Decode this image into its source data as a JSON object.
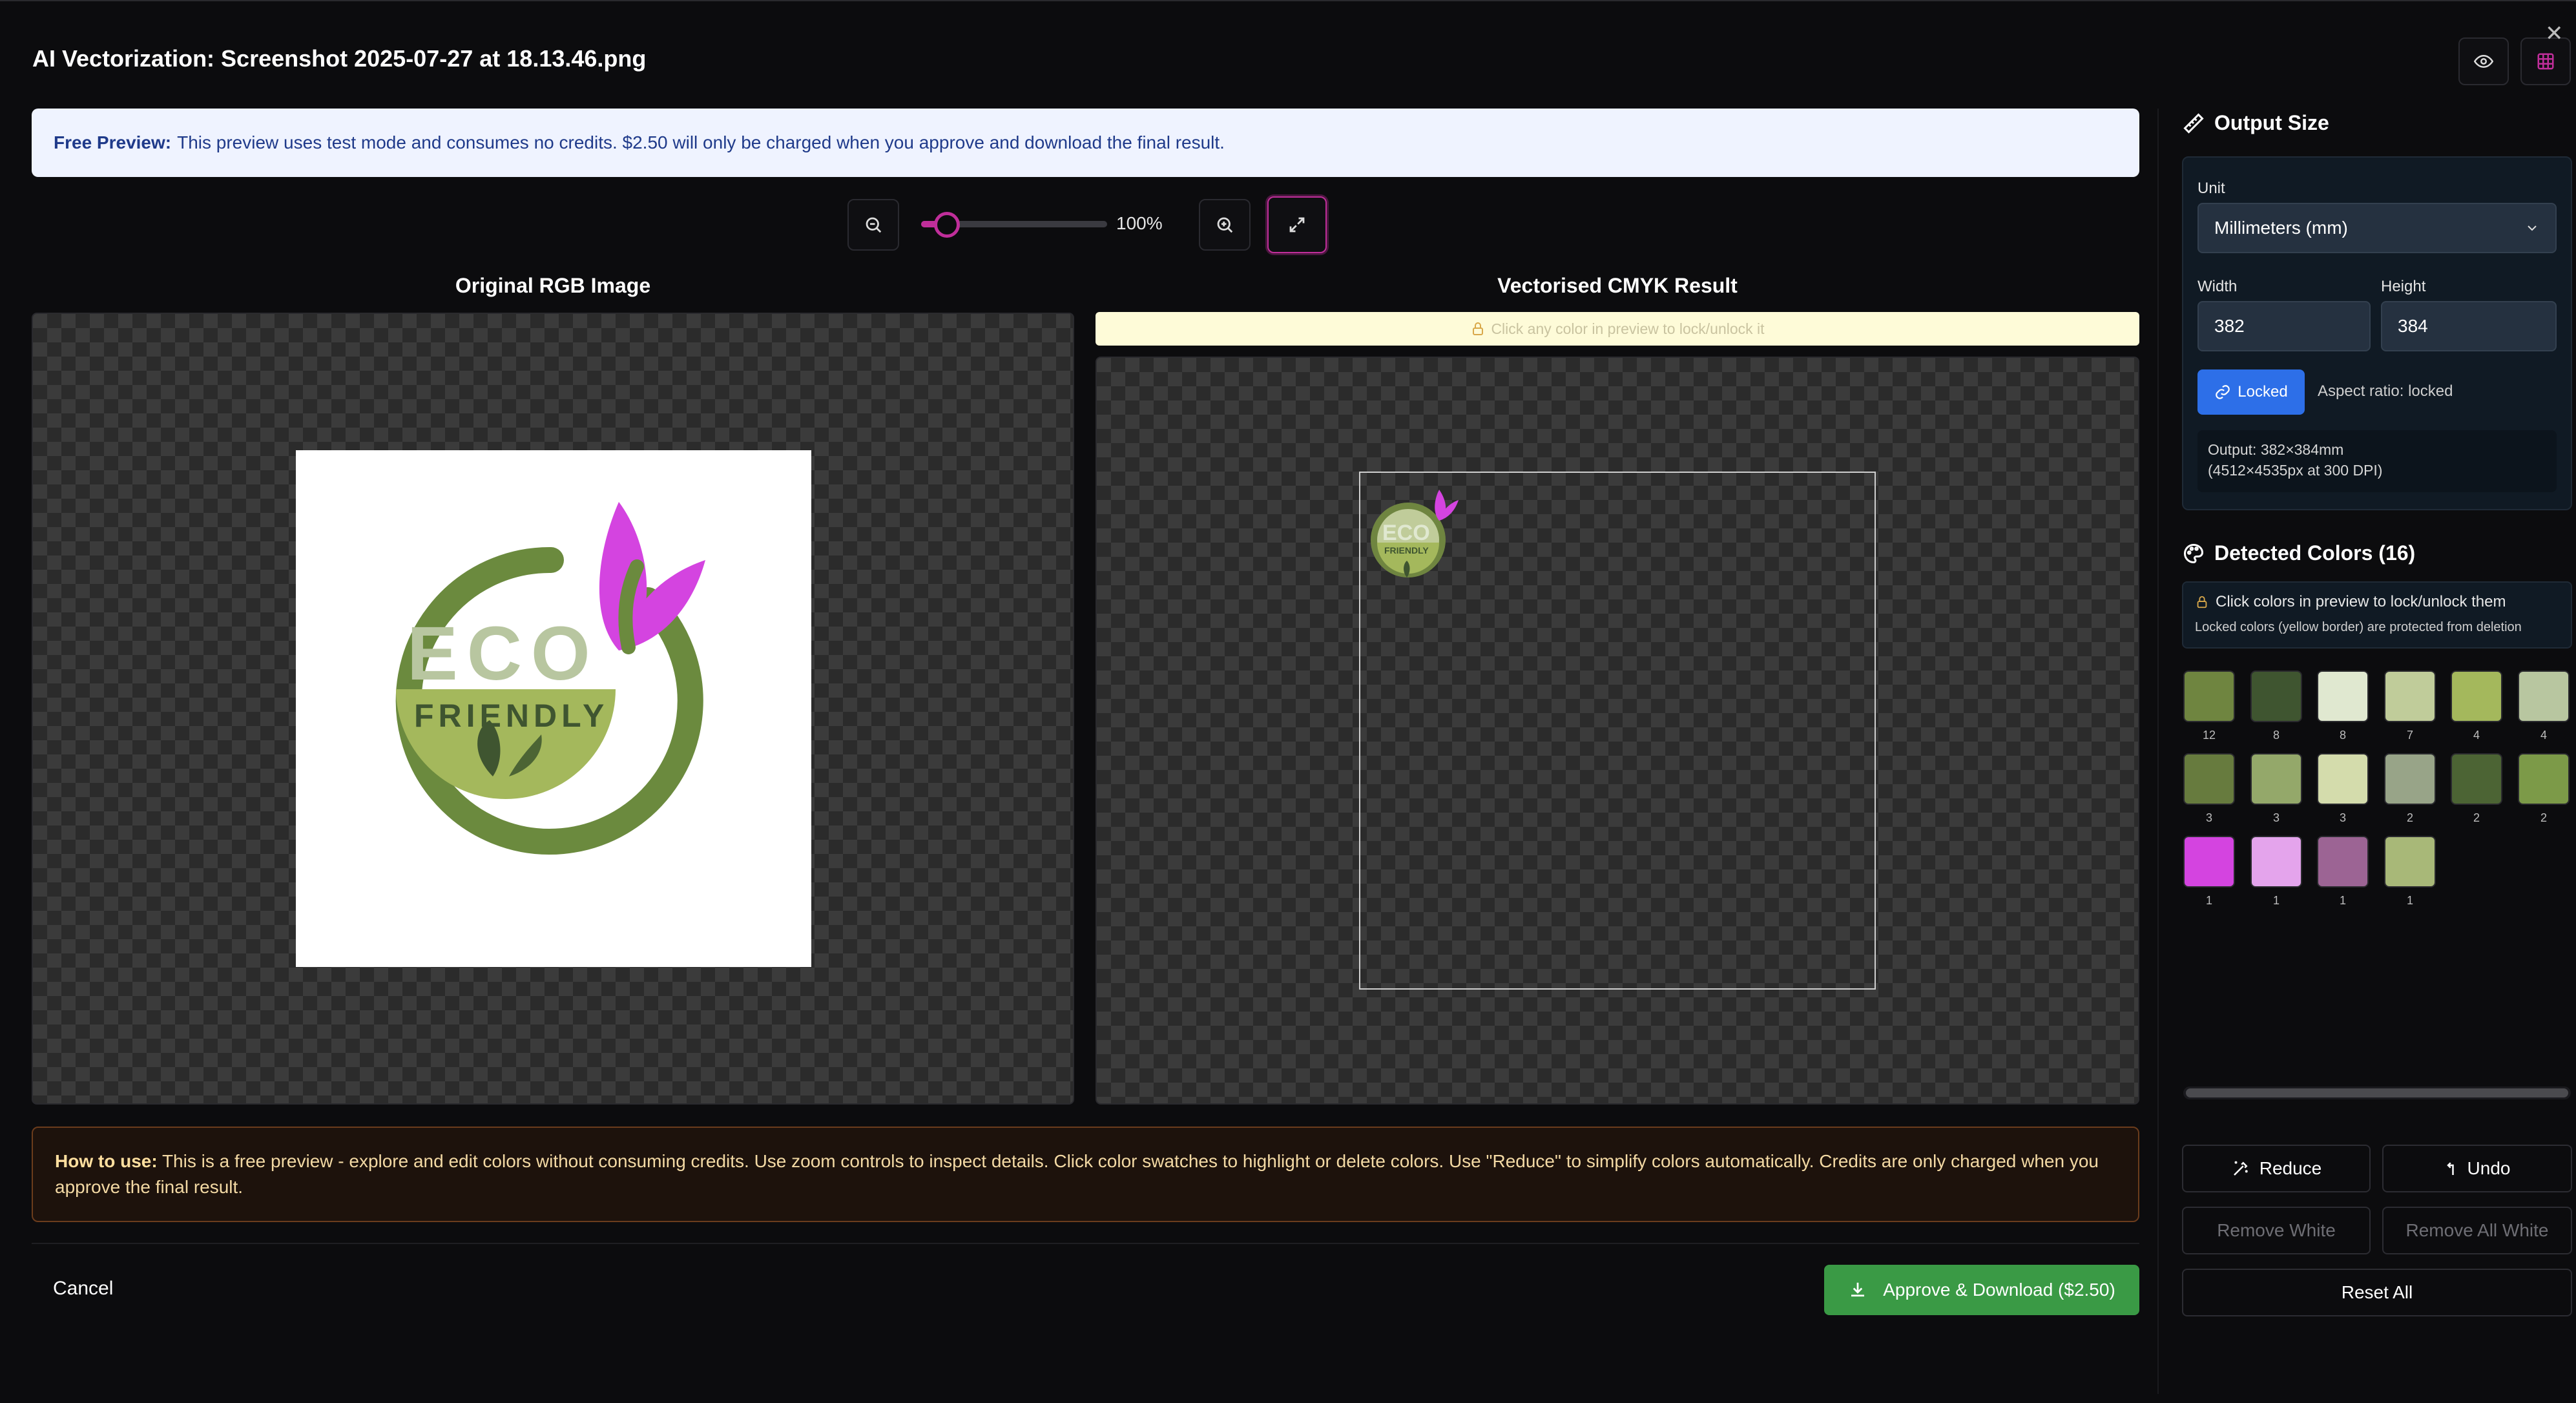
{
  "header": {
    "title": "AI Vectorization: Screenshot 2025-07-27 at 18.13.46.png",
    "preview_icon": "eye-icon",
    "grid_icon": "grid-icon",
    "close_icon": "close-icon"
  },
  "banner": {
    "label": "Free Preview:",
    "text": "This preview uses test mode and consumes no credits. $2.50 will only be charged when you approve and download the final result."
  },
  "zoom": {
    "percent": "100%",
    "slider_level": 0.05
  },
  "original": {
    "title": "Original RGB Image",
    "logo_top_text": "ECO",
    "logo_bottom_text": "FRIENDLY"
  },
  "result": {
    "title": "Vectorised CMYK Result",
    "lock_hint": "Click any color in preview to lock/unlock it",
    "logo_top_text": "ECO",
    "logo_bottom_text": "FRIENDLY"
  },
  "howto": {
    "label": "How to use:",
    "text": "This is a free preview - explore and edit colors without consuming credits. Use zoom controls to inspect details. Click color swatches to highlight or delete colors. Use \"Reduce\" to simplify colors automatically. Credits are only charged when you approve the final result."
  },
  "footer": {
    "cancel": "Cancel",
    "approve": "Approve & Download ($2.50)"
  },
  "output_size": {
    "title": "Output Size",
    "unit_label": "Unit",
    "unit_value": "Millimeters (mm)",
    "width_label": "Width",
    "width_value": "382",
    "height_label": "Height",
    "height_value": "384",
    "locked_label": "Locked",
    "aspect_text": "Aspect ratio: locked",
    "output_line1": "Output: 382×384mm",
    "output_line2": "(4512×4535px at 300 DPI)"
  },
  "detected": {
    "title": "Detected Colors (16)",
    "note_line1": "Click colors in preview to lock/unlock them",
    "note_line2": "Locked colors (yellow border) are protected from deletion",
    "swatches": [
      {
        "color": "#6f8540",
        "count": "12"
      },
      {
        "color": "#3f5530",
        "count": "8"
      },
      {
        "color": "#e0e8d0",
        "count": "8"
      },
      {
        "color": "#c0cc9a",
        "count": "7"
      },
      {
        "color": "#a4b85c",
        "count": "4"
      },
      {
        "color": "#b8c6a0",
        "count": "4"
      },
      {
        "color": "#677b3e",
        "count": "3"
      },
      {
        "color": "#94a86a",
        "count": "3"
      },
      {
        "color": "#d4dcac",
        "count": "3"
      },
      {
        "color": "#98a488",
        "count": "2"
      },
      {
        "color": "#4c6434",
        "count": "2"
      },
      {
        "color": "#7c9a48",
        "count": "2"
      },
      {
        "color": "#d444e0",
        "count": "1"
      },
      {
        "color": "#e4a4ec",
        "count": "1"
      },
      {
        "color": "#9c6494",
        "count": "1"
      },
      {
        "color": "#a8b878",
        "count": "1"
      }
    ]
  },
  "actions": {
    "reduce": "Reduce",
    "undo": "Undo",
    "remove_white": "Remove White",
    "remove_all_white": "Remove All White",
    "reset_all": "Reset All"
  }
}
